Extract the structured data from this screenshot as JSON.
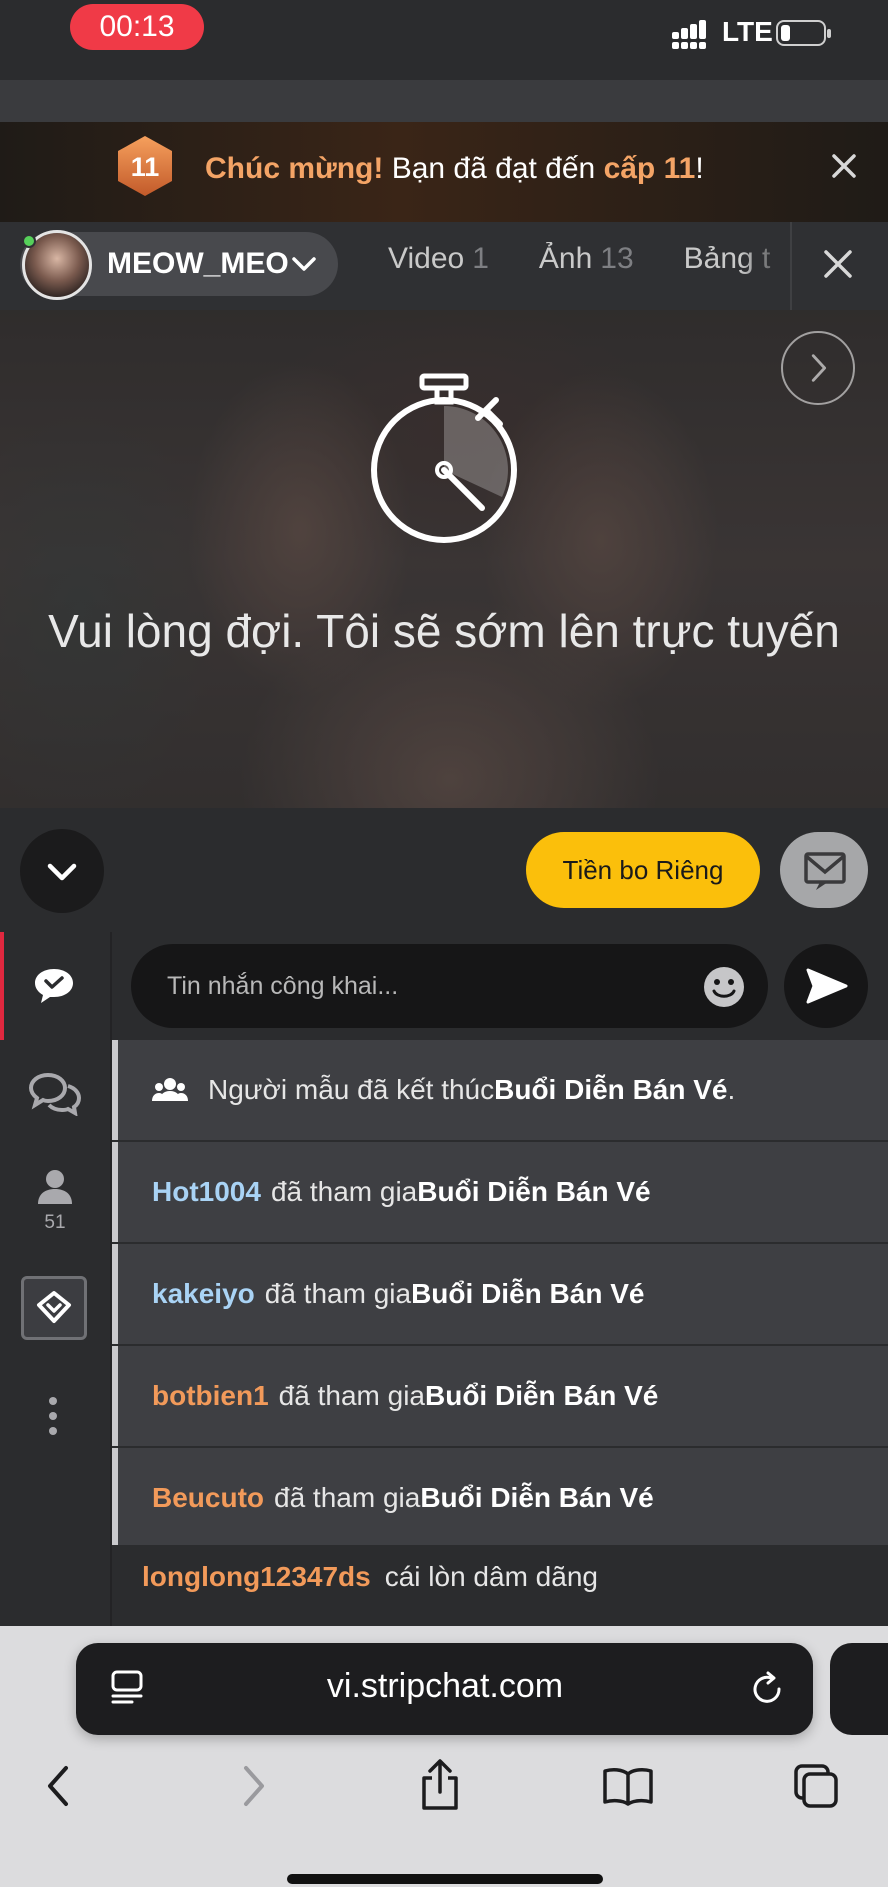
{
  "status_bar": {
    "recording_time": "00:13",
    "network": "LTE",
    "colors": {
      "recording": "#f03a47"
    }
  },
  "level_up_banner": {
    "level_badge": "11",
    "text_highlight_1": "Chúc mừng!",
    "text_middle": " Bạn đã đạt đến ",
    "text_highlight_2": "cấp 11",
    "text_end": "!",
    "close_icon": "close-icon",
    "colors": {
      "highlight": "#f4a466"
    }
  },
  "model_header": {
    "model_name": "MEOW_MEO",
    "online": true,
    "tabs": [
      {
        "label": "Video",
        "count": "1"
      },
      {
        "label": "Ảnh",
        "count": "13"
      },
      {
        "label": "Bảng t",
        "count": ""
      }
    ],
    "close_icon": "close-icon"
  },
  "video": {
    "status_message": "Vui lòng đợi. Tôi sẽ sớm lên trực tuyến",
    "icons": [
      "stopwatch-icon",
      "chevron-right-icon"
    ]
  },
  "controls": {
    "tip_button": "Tiền bo Riêng",
    "colors": {
      "tip_button": "#fbbf0b"
    }
  },
  "sidebar": {
    "users_count": "51",
    "icons": [
      "public-chat-icon",
      "private-chats-icon",
      "users-icon",
      "diamond-icon",
      "more-icon"
    ]
  },
  "chat": {
    "input_placeholder": "Tin nhắn công khai...",
    "messages": [
      {
        "prefix": "Người mẫu đã kết thúc ",
        "bold": "Buổi Diễn Bán Vé",
        "suffix": "."
      },
      {
        "user": "Hot1004",
        "text": "đã tham gia ",
        "bold": "Buổi Diễn Bán Vé"
      },
      {
        "user": "kakeiyo",
        "text": "đã tham gia ",
        "bold": "Buổi Diễn Bán Vé"
      },
      {
        "user": "botbien1",
        "text": "đã tham gia ",
        "bold": "Buổi Diễn Bán Vé"
      },
      {
        "user": "Beucuto",
        "text": "đã tham gia ",
        "bold": "Buổi Diễn Bán Vé"
      }
    ],
    "last_message": {
      "user": "longlong12347ds",
      "text": "cái lòn dâm dãng"
    },
    "colors": {
      "user_blue": "#a9d3f5",
      "user_orange": "#f29a5a"
    }
  },
  "safari": {
    "url": "vi.stripchat.com",
    "toolbar_icons": [
      "back-icon",
      "forward-icon",
      "share-icon",
      "bookmarks-icon",
      "tabs-icon"
    ]
  }
}
